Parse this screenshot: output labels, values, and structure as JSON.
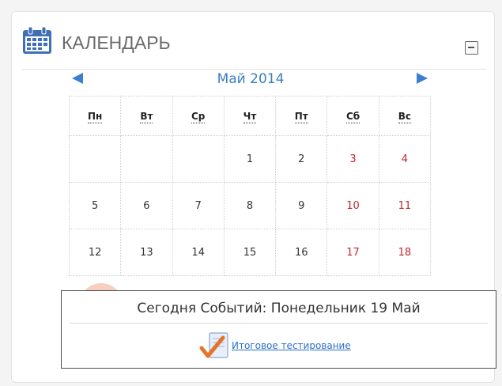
{
  "block": {
    "title": "КАЛЕНДАРЬ"
  },
  "calendar": {
    "month_title": "Май 2014",
    "weekdays": [
      "Пн",
      "Вт",
      "Ср",
      "Чт",
      "Пт",
      "Сб",
      "Вс"
    ],
    "weeks": [
      [
        "",
        "",
        "",
        "1",
        "2",
        "3",
        "4"
      ],
      [
        "5",
        "6",
        "7",
        "8",
        "9",
        "10",
        "11"
      ],
      [
        "12",
        "13",
        "14",
        "15",
        "16",
        "17",
        "18"
      ]
    ],
    "weekend_color": "#c0272d",
    "accent_color": "#3a7fc4"
  },
  "popup": {
    "title": "Сегодня Событий: Понедельник 19 Май",
    "event_label": "Итоговое тестирование"
  }
}
